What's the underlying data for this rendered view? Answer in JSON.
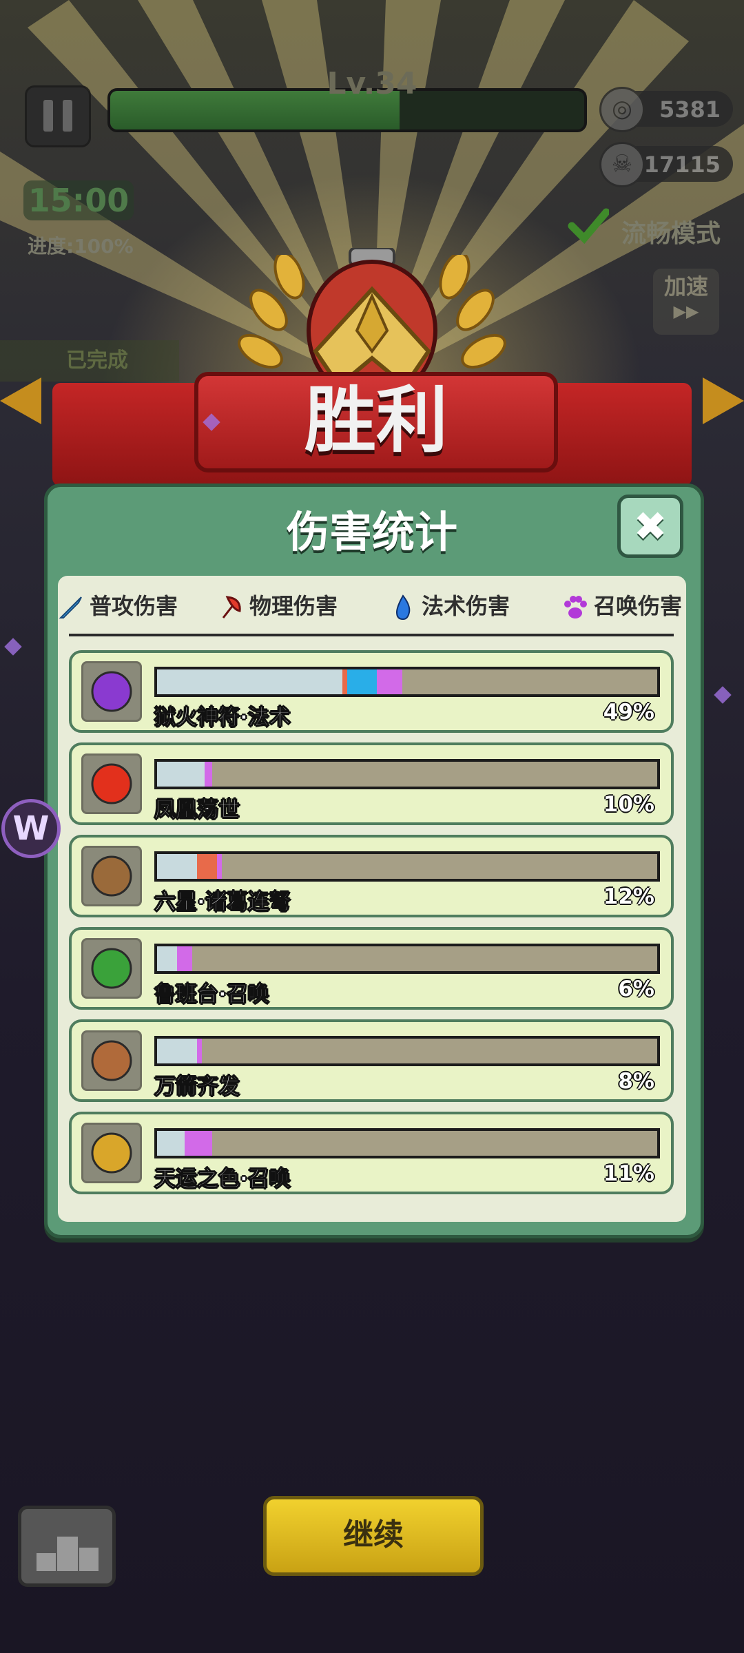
{
  "hud": {
    "level": "Lv.34",
    "level_progress": 0.61,
    "coins": "5381",
    "kills": "17115",
    "timer": "15:00",
    "progress": "进度:100%",
    "smooth_mode": "流畅模式",
    "speed_label": "加速",
    "speed_icon": "▶▶",
    "completed": "已完成"
  },
  "victory": {
    "title": "胜利"
  },
  "modal": {
    "title": "伤害统计",
    "close_icon": "✖",
    "tabs": [
      {
        "label": "普攻伤害",
        "icon": "sword-icon",
        "color": "#3aa7e6"
      },
      {
        "label": "物理伤害",
        "icon": "axe-icon",
        "color": "#e23a2a"
      },
      {
        "label": "法术伤害",
        "icon": "flame-icon",
        "color": "#2a78e0"
      },
      {
        "label": "召唤伤害",
        "icon": "paw-icon",
        "color": "#b23ad8"
      }
    ],
    "rows": [
      {
        "name": "狱火神符·法术",
        "percent": "49%",
        "icon": "rune-talisman-icon",
        "icon_color": "#8a3ad0",
        "segments": [
          {
            "share": 0.37,
            "color": "#c8dade"
          },
          {
            "share": 0.01,
            "color": "#e86a4a"
          },
          {
            "share": 0.06,
            "color": "#29aee8"
          },
          {
            "share": 0.05,
            "color": "#d26ae8"
          }
        ]
      },
      {
        "name": "凤凰荡世",
        "percent": "10%",
        "icon": "phoenix-icon",
        "icon_color": "#e2301c",
        "segments": [
          {
            "share": 0.095,
            "color": "#c8dade"
          },
          {
            "share": 0.015,
            "color": "#d26ae8"
          }
        ]
      },
      {
        "name": "六星·诸葛连弩",
        "percent": "12%",
        "icon": "crossbow-icon",
        "icon_color": "#9a6a3a",
        "segments": [
          {
            "share": 0.08,
            "color": "#c8dade"
          },
          {
            "share": 0.04,
            "color": "#e86a4a"
          },
          {
            "share": 0.01,
            "color": "#d26ae8"
          }
        ]
      },
      {
        "name": "鲁班台·召唤",
        "percent": "6%",
        "icon": "luban-platform-icon",
        "icon_color": "#3aa23a",
        "segments": [
          {
            "share": 0.04,
            "color": "#c8dade"
          },
          {
            "share": 0.03,
            "color": "#d26ae8"
          }
        ]
      },
      {
        "name": "万箭齐发",
        "percent": "8%",
        "icon": "bow-arrows-icon",
        "icon_color": "#b06a3a",
        "segments": [
          {
            "share": 0.08,
            "color": "#c8dade"
          },
          {
            "share": 0.01,
            "color": "#d26ae8"
          }
        ]
      },
      {
        "name": "天运之色·召唤",
        "percent": "11%",
        "icon": "golden-dice-icon",
        "icon_color": "#d9a62a",
        "segments": [
          {
            "share": 0.055,
            "color": "#c8dade"
          },
          {
            "share": 0.055,
            "color": "#d26ae8"
          }
        ]
      }
    ]
  },
  "bottom": {
    "continue_label": "继续",
    "podium_icon": "podium-icon"
  },
  "side_badge": "W"
}
